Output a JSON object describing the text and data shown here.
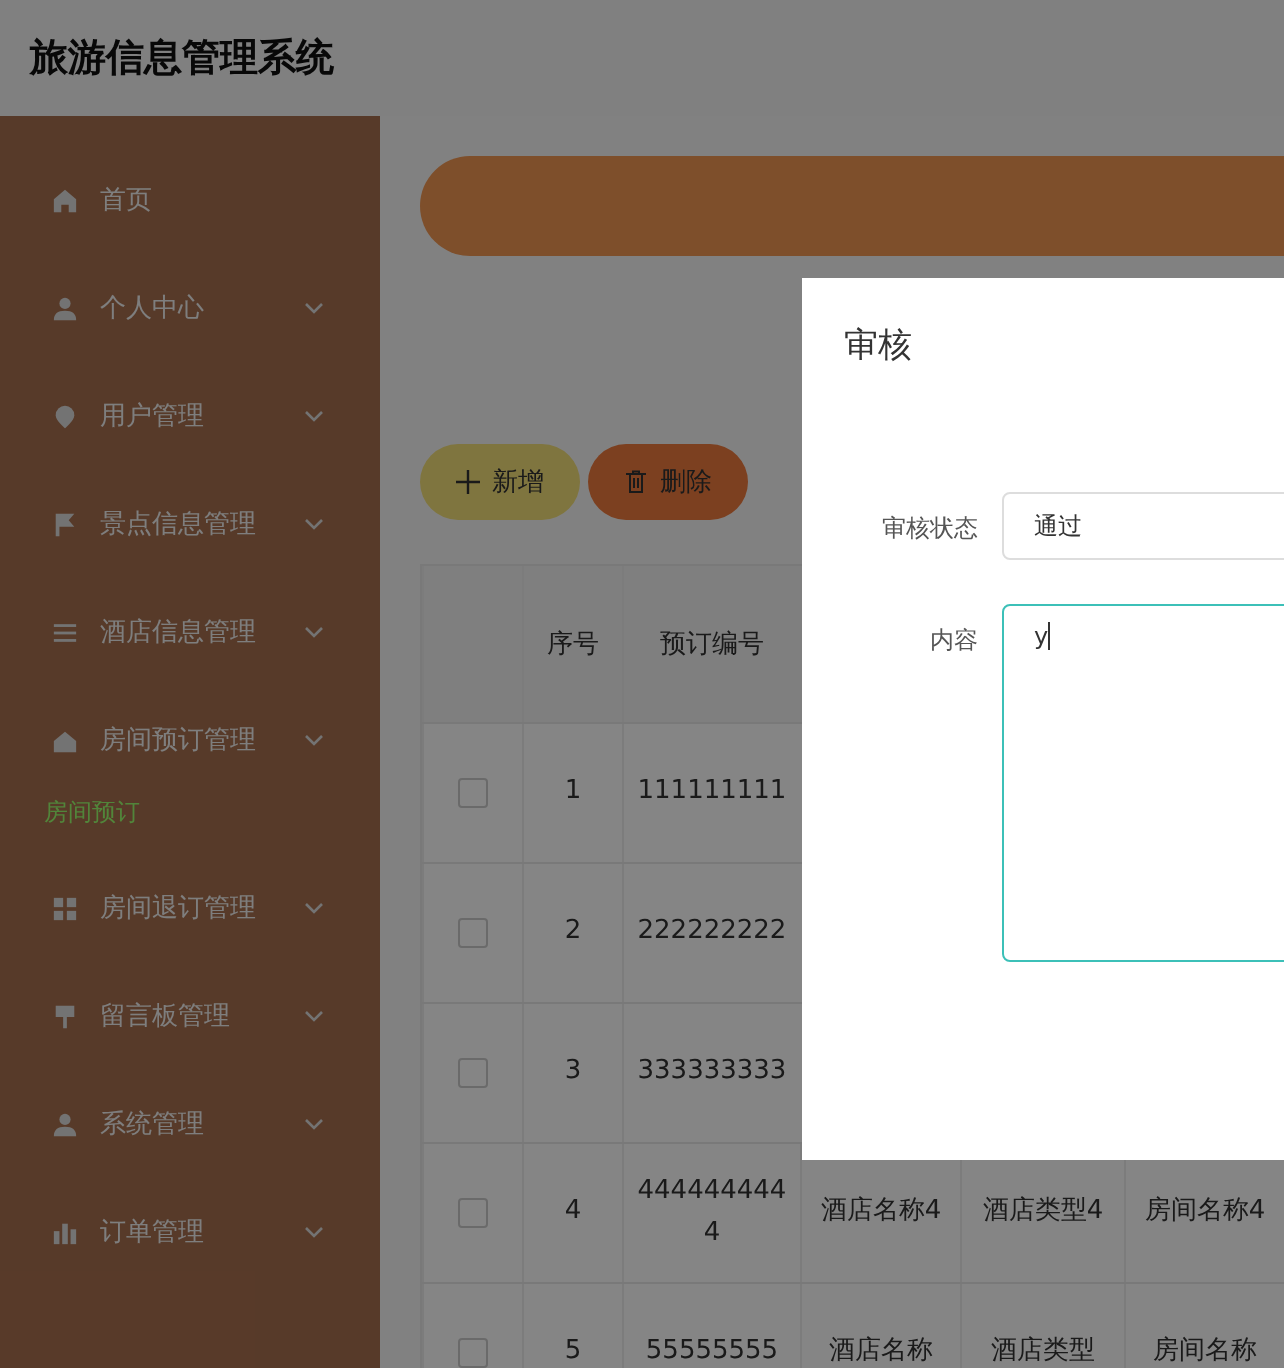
{
  "header": {
    "title": "旅游信息管理系统"
  },
  "sidebar": {
    "items": [
      {
        "label": "首页",
        "kind": "link"
      },
      {
        "label": "个人中心",
        "kind": "submenu"
      },
      {
        "label": "用户管理",
        "kind": "submenu"
      },
      {
        "label": "景点信息管理",
        "kind": "submenu"
      },
      {
        "label": "酒店信息管理",
        "kind": "submenu"
      },
      {
        "label": "房间预订管理",
        "kind": "submenu",
        "children": [
          {
            "label": "房间预订",
            "selected": true
          }
        ]
      },
      {
        "label": "房间退订管理",
        "kind": "submenu"
      },
      {
        "label": "留言板管理",
        "kind": "submenu"
      },
      {
        "label": "系统管理",
        "kind": "submenu"
      },
      {
        "label": "订单管理",
        "kind": "submenu"
      }
    ]
  },
  "toolbar": {
    "buttons": [
      {
        "label": "新增",
        "kind": "add"
      },
      {
        "label": "删除",
        "kind": "delete"
      }
    ]
  },
  "table": {
    "columns": [
      "序号",
      "预订编号"
    ],
    "rows": [
      {
        "checked": false,
        "cells": [
          "1",
          "111111111"
        ]
      },
      {
        "checked": false,
        "cells": [
          "2",
          "222222222"
        ]
      },
      {
        "checked": false,
        "cells": [
          "3",
          "333333333"
        ]
      },
      {
        "checked": false,
        "cells": [
          "4",
          "4444444444",
          "酒店名称4",
          "酒店类型4",
          "房间名称4"
        ]
      },
      {
        "checked": false,
        "cells": [
          "5",
          "55555555",
          "酒店名称",
          "酒店类型",
          "房间名称"
        ]
      }
    ]
  },
  "dialog": {
    "title": "审核",
    "fields": [
      {
        "label": "审核状态",
        "kind": "select",
        "value": "通过"
      },
      {
        "label": "内容",
        "kind": "textarea",
        "value": "y"
      }
    ]
  }
}
